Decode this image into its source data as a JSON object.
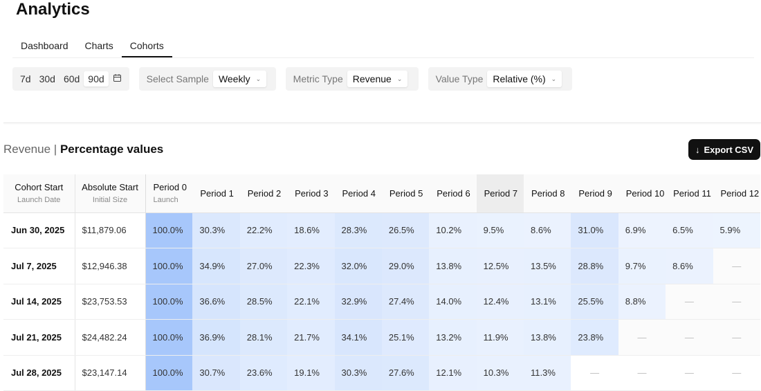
{
  "title": "Analytics",
  "tabs": [
    {
      "label": "Dashboard"
    },
    {
      "label": "Charts"
    },
    {
      "label": "Cohorts",
      "active": true
    }
  ],
  "range": {
    "options": [
      "7d",
      "30d",
      "60d",
      "90d"
    ],
    "selected": "90d",
    "calendar_icon": "calendar-icon"
  },
  "sample": {
    "label": "Select Sample",
    "value": "Weekly"
  },
  "metric": {
    "label": "Metric Type",
    "value": "Revenue"
  },
  "valuetype": {
    "label": "Value Type",
    "value": "Relative (%)"
  },
  "subtitle": {
    "metric": "Revenue",
    "sep": " | ",
    "mode": "Percentage values"
  },
  "export_label": "Export CSV",
  "accent": "#3b82f6",
  "table": {
    "headers": [
      {
        "label": "Cohort Start",
        "sub": "Launch Date"
      },
      {
        "label": "Absolute Start",
        "sub": "Initial Size"
      },
      {
        "label": "Period 0",
        "sub": "Launch"
      },
      {
        "label": "Period 1"
      },
      {
        "label": "Period 2"
      },
      {
        "label": "Period 3"
      },
      {
        "label": "Period 4"
      },
      {
        "label": "Period 5"
      },
      {
        "label": "Period 6"
      },
      {
        "label": "Period 7"
      },
      {
        "label": "Period 8"
      },
      {
        "label": "Period 9"
      },
      {
        "label": "Period 10"
      },
      {
        "label": "Period 11"
      },
      {
        "label": "Period 12"
      }
    ],
    "empty": "—",
    "rows": [
      {
        "date": "Jun 30, 2025",
        "start": "$11,879.06",
        "values": [
          "100.0%",
          "30.3%",
          "22.2%",
          "18.6%",
          "28.3%",
          "26.5%",
          "10.2%",
          "9.5%",
          "8.6%",
          "31.0%",
          "6.9%",
          "6.5%",
          "5.9%"
        ]
      },
      {
        "date": "Jul 7, 2025",
        "start": "$12,946.38",
        "values": [
          "100.0%",
          "34.9%",
          "27.0%",
          "22.3%",
          "32.0%",
          "29.0%",
          "13.8%",
          "12.5%",
          "13.5%",
          "28.8%",
          "9.7%",
          "8.6%",
          null
        ]
      },
      {
        "date": "Jul 14, 2025",
        "start": "$23,753.53",
        "values": [
          "100.0%",
          "36.6%",
          "28.5%",
          "22.1%",
          "32.9%",
          "27.4%",
          "14.0%",
          "12.4%",
          "13.1%",
          "25.5%",
          "8.8%",
          null,
          null
        ]
      },
      {
        "date": "Jul 21, 2025",
        "start": "$24,482.24",
        "values": [
          "100.0%",
          "36.9%",
          "28.1%",
          "21.7%",
          "34.1%",
          "25.1%",
          "13.2%",
          "11.9%",
          "13.8%",
          "23.8%",
          null,
          null,
          null
        ]
      },
      {
        "date": "Jul 28, 2025",
        "start": "$23,147.14",
        "values": [
          "100.0%",
          "30.7%",
          "23.6%",
          "19.1%",
          "30.3%",
          "27.6%",
          "12.1%",
          "10.3%",
          "11.3%",
          null,
          null,
          null,
          null
        ]
      }
    ]
  }
}
